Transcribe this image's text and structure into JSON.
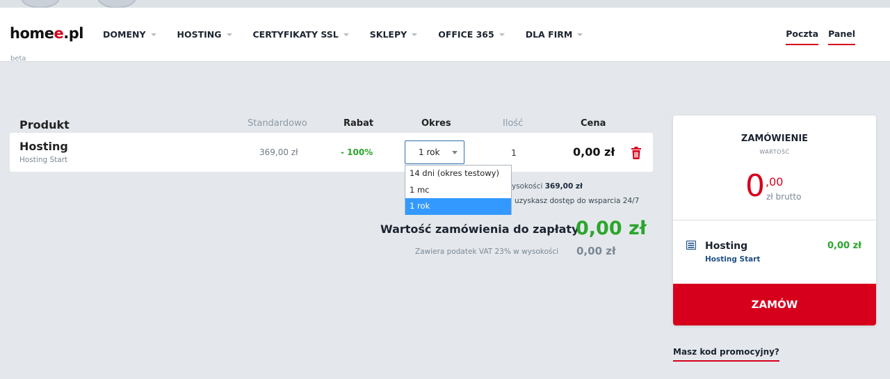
{
  "header": {
    "logo_main": "home",
    "logo_e": "e",
    "logo_tld": ".pl",
    "logo_badge": "beta",
    "nav": [
      {
        "label": "DOMENY",
        "has_caret": true
      },
      {
        "label": "HOSTING",
        "has_caret": true
      },
      {
        "label": "CERTYFIKATY SSL",
        "has_caret": true
      },
      {
        "label": "SKLEPY",
        "has_caret": true
      },
      {
        "label": "OFFICE 365",
        "has_caret": true
      },
      {
        "label": "DLA FIRM",
        "has_caret": true
      }
    ],
    "links": {
      "poczta": "Poczta",
      "panel": "Panel"
    }
  },
  "table": {
    "headers": {
      "product": "Produkt",
      "standard": "Standardowo",
      "discount": "Rabat",
      "period": "Okres",
      "quantity": "Ilość",
      "price": "Cena"
    },
    "row": {
      "name": "Hosting",
      "subname": "Hosting Start",
      "standard_price": "369,00 zł",
      "discount": "- 100%",
      "period_selected": "1 rok",
      "quantity": "1",
      "price": "0,00 zł",
      "delete_icon": "trash-icon"
    },
    "period_options": [
      "14 dni (okres testowy)",
      "1 mc",
      "1 rok"
    ],
    "period_selected_index": 2
  },
  "summary": {
    "vat_line_tail": "ysokości",
    "vat_line_value": "369,00 zł",
    "support_tail": "uzyskasz dostęp do wsparcia 24/7",
    "total_label": "Wartość zamówienia do zapłaty",
    "total_value": "0,00 zł",
    "vat_label": "Zawiera podatek VAT 23% w wysokości",
    "vat_value": "0,00 zł"
  },
  "order_card": {
    "title": "ZAMÓWIENIE",
    "subtitle": "WARTOŚĆ",
    "amount_main": "0",
    "amount_cents": ",00",
    "amount_unit": "zł brutto",
    "item_name": "Hosting",
    "item_sub": "Hosting Start",
    "item_price": "0,00 zł",
    "item_icon": "server-icon",
    "order_button": "ZAMÓW"
  },
  "promo_link": "Masz kod promocyjny?",
  "colors": {
    "brand_red": "#d6001c",
    "green": "#2ca52c",
    "selected_option": "#3399ff"
  }
}
